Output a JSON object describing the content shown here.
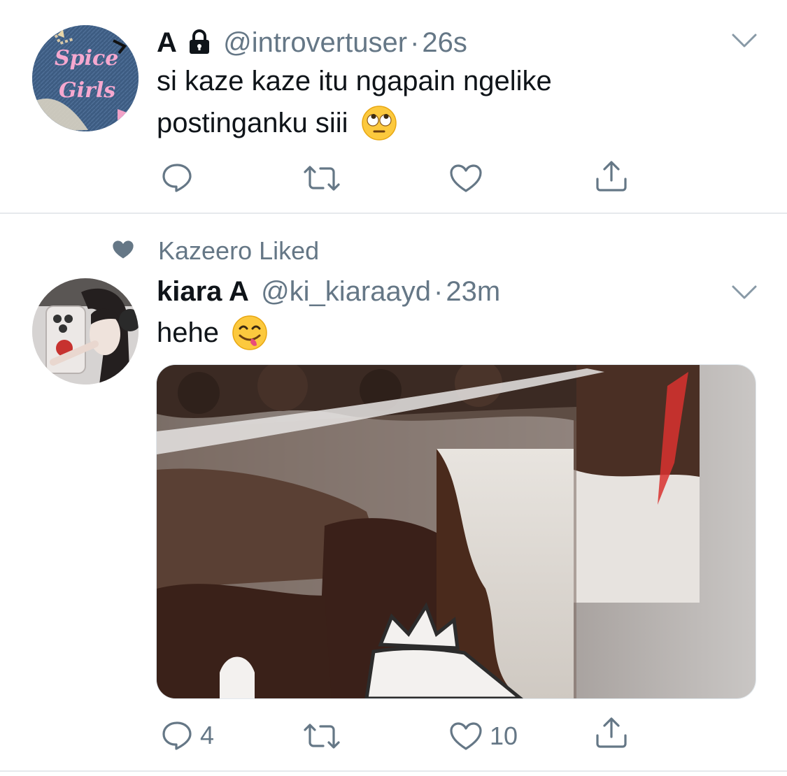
{
  "tweets": [
    {
      "name": "A",
      "locked": true,
      "handle": "@introvertuser",
      "separator": "·",
      "time": "26s",
      "text_line1": "si kaze kaze itu ngapain ngelike",
      "text_line2": "postinganku siii",
      "emoji": "face-with-rolling-eyes",
      "avatar_text_1": "Spice",
      "avatar_text_2": "Girls",
      "reply_count": "",
      "retweet_count": "",
      "like_count": ""
    },
    {
      "social_context": "Kazeero Liked",
      "name": "kiara A",
      "handle": "@ki_kiaraayd",
      "separator": "·",
      "time": "23m",
      "text": "hehe",
      "emoji": "face-savoring-food",
      "reply_count": "4",
      "retweet_count": "",
      "like_count": "10"
    }
  ],
  "colors": {
    "secondary_text": "#657786",
    "divider": "#e6e9ec",
    "primary_text": "#0f1419"
  }
}
